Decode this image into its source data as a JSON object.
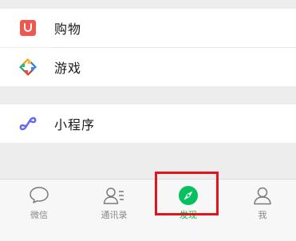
{
  "discover_list": {
    "items": [
      {
        "label": "购物",
        "icon": "shopping-bag-icon"
      },
      {
        "label": "游戏",
        "icon": "games-pinwheel-icon"
      },
      {
        "label": "小程序",
        "icon": "mini-program-icon"
      }
    ]
  },
  "tabbar": {
    "tabs": [
      {
        "label": "微信",
        "icon": "chat-bubble-icon"
      },
      {
        "label": "通讯录",
        "icon": "contacts-icon"
      },
      {
        "label": "发现",
        "icon": "compass-icon"
      },
      {
        "label": "我",
        "icon": "person-icon"
      }
    ],
    "active_tab": "发现"
  },
  "colors": {
    "accent_green": "#07c160",
    "highlight_red": "#e0161c",
    "shopping_red": "#f0584f",
    "mini_program_purple": "#6467f0"
  }
}
